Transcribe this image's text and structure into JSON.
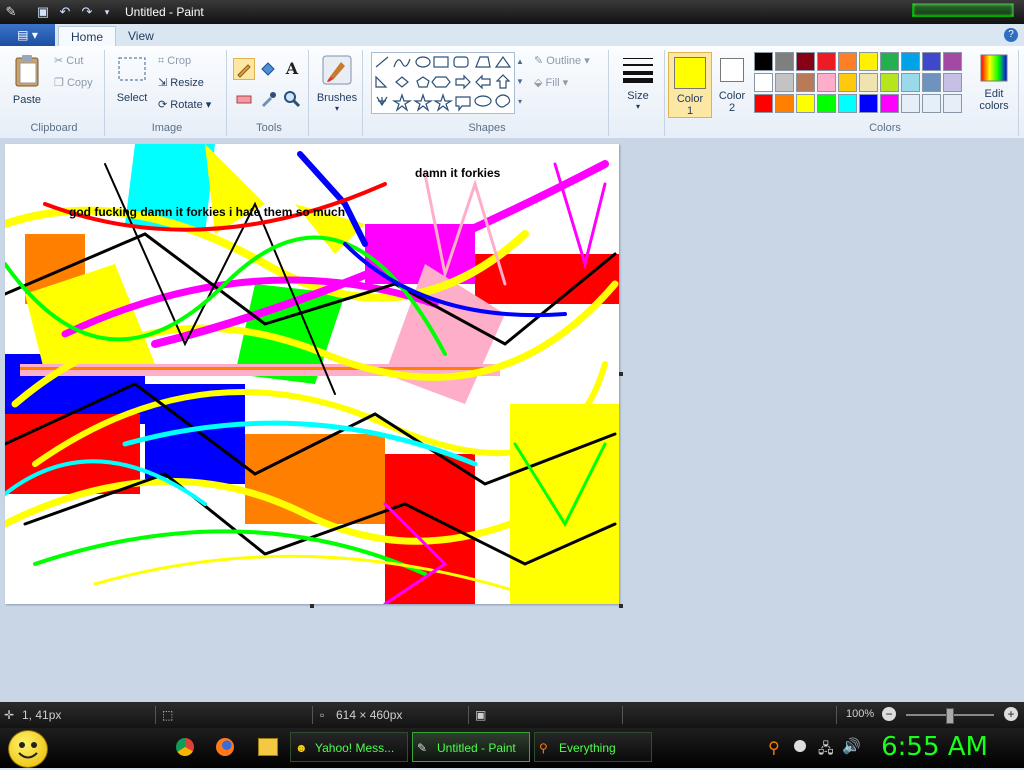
{
  "window": {
    "title": "Untitled - Paint"
  },
  "menu": {
    "file_label": "▤ ▾",
    "tabs": [
      "Home",
      "View"
    ],
    "help": "?"
  },
  "ribbon": {
    "clipboard": {
      "label": "Clipboard",
      "paste": "Paste",
      "cut": "Cut",
      "copy": "Copy"
    },
    "image": {
      "label": "Image",
      "select": "Select",
      "crop": "Crop",
      "resize": "Resize",
      "rotate": "Rotate"
    },
    "tools": {
      "label": "Tools"
    },
    "brushes": {
      "label": "Brushes"
    },
    "shapes": {
      "label": "Shapes",
      "outline": "Outline",
      "fill": "Fill"
    },
    "size": {
      "label": "Size"
    },
    "color1": {
      "label1": "Color",
      "label2": "1",
      "value": "#ffff00"
    },
    "color2": {
      "label1": "Color",
      "label2": "2",
      "value": "#ffffff"
    },
    "colors": {
      "label": "Colors",
      "edit1": "Edit",
      "edit2": "colors"
    },
    "palette": [
      "#000000",
      "#7f7f7f",
      "#880015",
      "#ed1c24",
      "#ff7f27",
      "#fff200",
      "#22b14c",
      "#00a2e8",
      "#3f48cc",
      "#a349a4",
      "#ffffff",
      "#c3c3c3",
      "#b97a57",
      "#ffaec9",
      "#ffc90e",
      "#efe4b0",
      "#b5e61d",
      "#99d9ea",
      "#7092be",
      "#c8bfe7",
      "#ff0000",
      "#ff8000",
      "#ffff00",
      "#00ff00",
      "#00ffff",
      "#0000ff",
      "#ff00ff",
      "#e6eef7",
      "#e6eef7",
      "#e6eef7"
    ]
  },
  "canvas": {
    "text1": "damn it forkies",
    "text2": "god fucking damn it forkies i hate them so much"
  },
  "status": {
    "position": "1, 41px",
    "size": "614 × 460px",
    "zoom": "100%"
  },
  "taskbar": {
    "items": [
      {
        "label": "Yahoo! Mess..."
      },
      {
        "label": "Untitled - Paint"
      },
      {
        "label": "Everything"
      }
    ],
    "clock": "6:55 AM"
  }
}
